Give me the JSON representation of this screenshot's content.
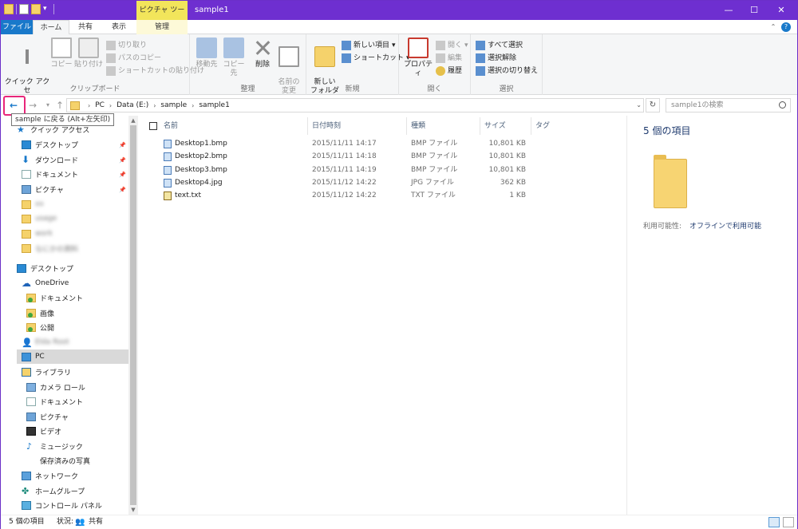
{
  "window": {
    "title": "sample1",
    "contextual_tab": "ピクチャ ツール"
  },
  "ribbon_tabs": {
    "file": "ファイル",
    "home": "ホーム",
    "share": "共有",
    "view": "表示",
    "manage": "管理"
  },
  "ribbon": {
    "clipboard": {
      "label": "クリップボード",
      "pin": "クイック アクセ\nスにピン留め",
      "copy": "コピー",
      "paste": "貼り付け",
      "cut": "切り取り",
      "copy_path": "パスのコピー",
      "paste_shortcut": "ショートカットの貼り付け"
    },
    "organize": {
      "label": "整理",
      "move_to": "移動先",
      "copy_to": "コピー先",
      "delete": "削除",
      "rename": "名前の\n変更"
    },
    "new": {
      "label": "新規",
      "new_folder": "新しい\nフォルダー",
      "new_item": "新しい項目",
      "shortcut": "ショートカット"
    },
    "open": {
      "label": "開く",
      "properties": "プロパティ",
      "open": "開く",
      "edit": "編集",
      "history": "履歴"
    },
    "select": {
      "label": "選択",
      "select_all": "すべて選択",
      "select_none": "選択解除",
      "invert": "選択の切り替え"
    }
  },
  "address": {
    "crumbs": [
      "PC",
      "Data (E:)",
      "sample",
      "sample1"
    ],
    "search_placeholder": "sample1の検索"
  },
  "tooltip": "sample に戻る (Alt+左矢印)",
  "navpane": {
    "quick_access": "クイック アクセス",
    "desktop": "デスクトップ",
    "downloads": "ダウンロード",
    "documents": "ドキュメント",
    "pictures": "ピクチャ",
    "blurred1": "xx",
    "blurred2": "usage",
    "blurred3": "work",
    "blurred4": "なにかの資料",
    "desktop2": "デスクトップ",
    "onedrive": "OneDrive",
    "od_documents": "ドキュメント",
    "od_images": "画像",
    "od_public": "公開",
    "user": "Elda Root",
    "pc": "PC",
    "libraries": "ライブラリ",
    "camera_roll": "カメラ ロール",
    "lib_documents": "ドキュメント",
    "lib_pictures": "ピクチャ",
    "lib_videos": "ビデオ",
    "lib_music": "ミュージック",
    "saved_pictures": "保存済みの写真",
    "network": "ネットワーク",
    "homegroup": "ホームグループ",
    "control_panel": "コントロール パネル"
  },
  "columns": {
    "name": "名前",
    "date": "日付時刻",
    "type": "種類",
    "size": "サイズ",
    "tag": "タグ"
  },
  "files": [
    {
      "name": "Desktop1.bmp",
      "date": "2015/11/11 14:17",
      "type": "BMP ファイル",
      "size": "10,801 KB"
    },
    {
      "name": "Desktop2.bmp",
      "date": "2015/11/11 14:18",
      "type": "BMP ファイル",
      "size": "10,801 KB"
    },
    {
      "name": "Desktop3.bmp",
      "date": "2015/11/11 14:19",
      "type": "BMP ファイル",
      "size": "10,801 KB"
    },
    {
      "name": "Desktop4.jpg",
      "date": "2015/11/12 14:22",
      "type": "JPG ファイル",
      "size": "362 KB"
    },
    {
      "name": "text.txt",
      "date": "2015/11/12 14:22",
      "type": "TXT ファイル",
      "size": "1 KB"
    }
  ],
  "details": {
    "count": "5 個の項目",
    "availability_label": "利用可能性:",
    "availability_value": "オフラインで利用可能"
  },
  "status": {
    "count": "5 個の項目",
    "state_label": "状況:",
    "state_value": "共有"
  }
}
